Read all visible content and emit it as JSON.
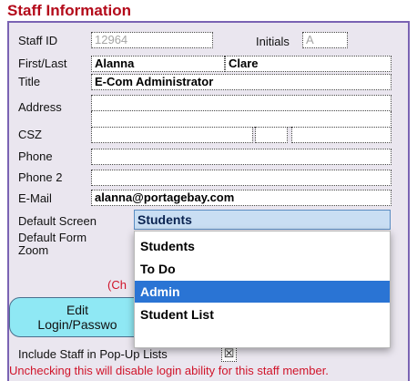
{
  "title": "Staff Information",
  "fields": {
    "staff_id": {
      "label": "Staff ID",
      "value": "12964"
    },
    "initials": {
      "label": "Initials",
      "value": "A"
    },
    "first_last": {
      "label": "First/Last",
      "first": "Alanna",
      "last": "Clare"
    },
    "title": {
      "label": "Title",
      "value": "E-Com Administrator"
    },
    "address": {
      "label": "Address",
      "value": ""
    },
    "csz": {
      "label": "CSZ",
      "city": "",
      "state": "",
      "zip": ""
    },
    "phone": {
      "label": "Phone",
      "value": ""
    },
    "phone2": {
      "label": "Phone 2",
      "value": ""
    },
    "email": {
      "label": "E-Mail",
      "value": "alanna@portagebay.com"
    }
  },
  "default_screen": {
    "label": "Default Screen",
    "value": "Students"
  },
  "default_form_zoom": {
    "label_line1": "Default Form",
    "label_line2": "Zoom"
  },
  "dropdown": {
    "options": [
      "Students",
      "To Do",
      "Admin",
      "Student List"
    ],
    "highlighted": "Admin"
  },
  "hint_text": "(Ch",
  "edit_button": {
    "line1": "Edit",
    "line2": "Login/Passwo"
  },
  "include_popup": {
    "label": "Include Staff in Pop-Up Lists",
    "mark": "☒"
  },
  "warning": "Unchecking this will disable login ability for this staff member.",
  "colors": {
    "title": "#b40a1a",
    "panel": "#eae6ef",
    "border": "#7a63b3",
    "highlight": "#2a74d4",
    "button": "#8fe8f4",
    "warning": "#d0142a"
  }
}
